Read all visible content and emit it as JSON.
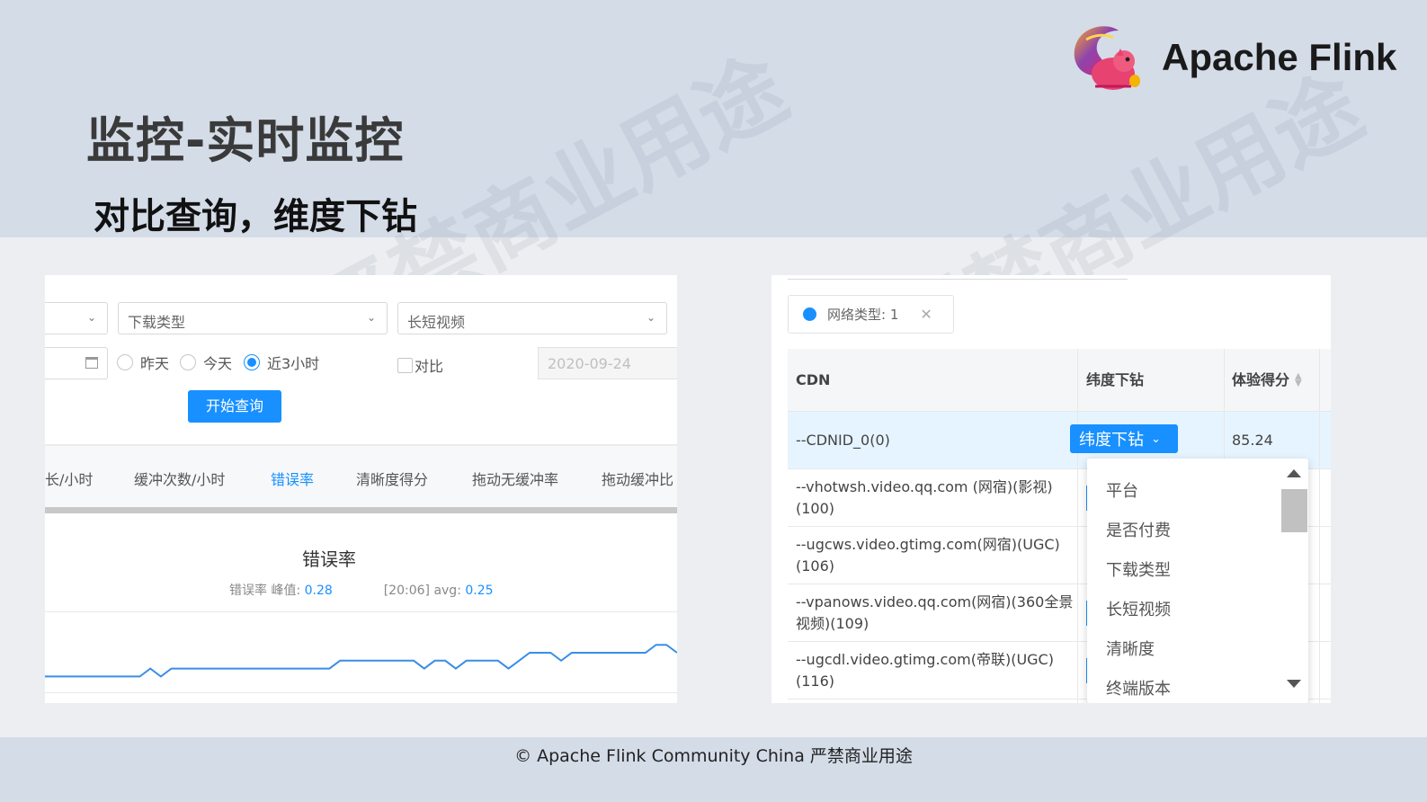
{
  "slide": {
    "title": "监控-实时监控",
    "subtitle": "对比查询，维度下钻",
    "brand": "Apache Flink",
    "footer": "© Apache Flink Community China  严禁商业用途",
    "watermark": "严禁商业用途"
  },
  "query_panel": {
    "selects": [
      "下载类型",
      "长短视频"
    ],
    "radios": [
      {
        "label": "昨天",
        "checked": false
      },
      {
        "label": "今天",
        "checked": false
      },
      {
        "label": "近3小时",
        "checked": true
      }
    ],
    "compare_label": "对比",
    "compare_date": "2020-09-24",
    "search_button": "开始查询",
    "tabs": [
      "长/小时",
      "缓冲次数/小时",
      "错误率",
      "清晰度得分",
      "拖动无缓冲率",
      "拖动缓冲比"
    ],
    "active_tab": "错误率",
    "chart": {
      "title": "错误率",
      "peak_label": "错误率 峰值:",
      "peak_value": "0.28",
      "peak_time": "[20:06]",
      "avg_label": "avg:",
      "avg_value": "0.25"
    }
  },
  "chart_data": {
    "type": "line",
    "title": "错误率",
    "series": [
      {
        "values": [
          0.22,
          0.22,
          0.22,
          0.22,
          0.22,
          0.22,
          0.22,
          0.22,
          0.22,
          0.22,
          0.23,
          0.22,
          0.23,
          0.23,
          0.23,
          0.23,
          0.23,
          0.23,
          0.23,
          0.23,
          0.23,
          0.23,
          0.23,
          0.23,
          0.23,
          0.23,
          0.23,
          0.23,
          0.24,
          0.24,
          0.24,
          0.24,
          0.24,
          0.24,
          0.24,
          0.24,
          0.23,
          0.24,
          0.24,
          0.23,
          0.24,
          0.24,
          0.24,
          0.24,
          0.23,
          0.24,
          0.25,
          0.25,
          0.25,
          0.24,
          0.25,
          0.25,
          0.25,
          0.25,
          0.25,
          0.25,
          0.25,
          0.25,
          0.26,
          0.26,
          0.25
        ]
      }
    ],
    "ylim": [
      0.2,
      0.3
    ],
    "grid": false,
    "color": "#3a8ee6"
  },
  "drill_panel": {
    "filter_tag": "网络类型: 1",
    "headers": {
      "cdn": "CDN",
      "drill": "纬度下钻",
      "score": "体验得分"
    },
    "rows": [
      {
        "cdn": "--CDNID_0(0)",
        "score": "85.24"
      },
      {
        "cdn": "--vhotwsh.video.qq.com (网宿)(影视)(100)"
      },
      {
        "cdn": "--ugcws.video.gtimg.com(网宿)(UGC)(106)"
      },
      {
        "cdn": "--vpanows.video.qq.com(网宿)(360全景视频)(109)"
      },
      {
        "cdn": "--ugcdl.video.gtimg.com(帝联)(UGC)(116)"
      }
    ],
    "drill_button": "纬度下钻",
    "dropdown_items": [
      "平台",
      "是否付费",
      "下载类型",
      "长短视频",
      "清晰度",
      "终端版本"
    ]
  }
}
